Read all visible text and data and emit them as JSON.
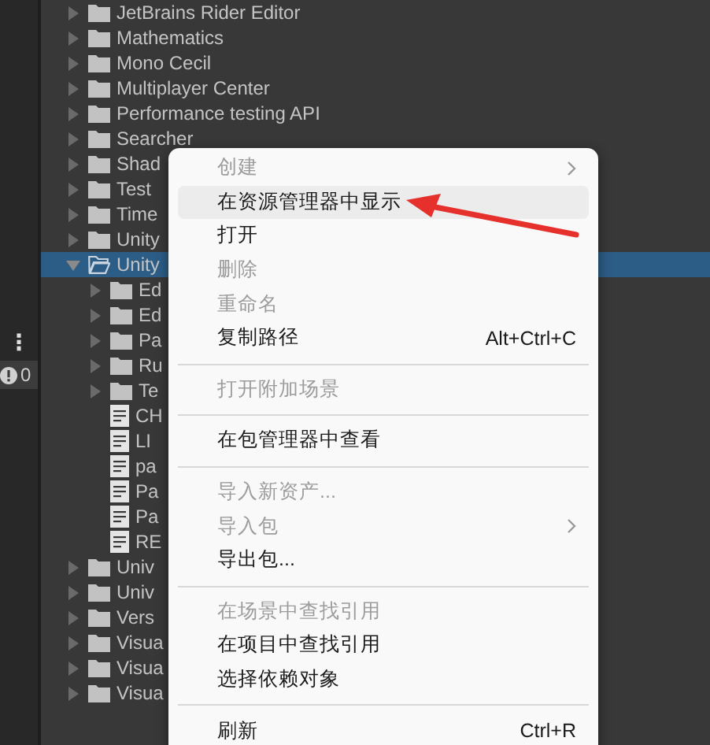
{
  "side_strip": {
    "more_glyph": "⋮",
    "count": "0"
  },
  "tree": [
    {
      "label": "JetBrains Rider Editor",
      "kind": "folder",
      "expanded": false,
      "selected": false
    },
    {
      "label": "Mathematics",
      "kind": "folder",
      "expanded": false,
      "selected": false
    },
    {
      "label": "Mono Cecil",
      "kind": "folder",
      "expanded": false,
      "selected": false
    },
    {
      "label": "Multiplayer Center",
      "kind": "folder",
      "expanded": false,
      "selected": false
    },
    {
      "label": "Performance testing API",
      "kind": "folder",
      "expanded": false,
      "selected": false
    },
    {
      "label": "Searcher",
      "kind": "folder",
      "expanded": false,
      "selected": false
    },
    {
      "label": "Shad",
      "kind": "folder",
      "expanded": false,
      "selected": false
    },
    {
      "label": "Test",
      "kind": "folder",
      "expanded": false,
      "selected": false
    },
    {
      "label": "Time",
      "kind": "folder",
      "expanded": false,
      "selected": false
    },
    {
      "label": "Unity",
      "kind": "folder",
      "expanded": false,
      "selected": false
    },
    {
      "label": "Unity",
      "kind": "folder",
      "expanded": true,
      "selected": true,
      "children": [
        {
          "label": "Ed",
          "kind": "folder",
          "expanded": false,
          "selected": false
        },
        {
          "label": "Ed",
          "kind": "folder",
          "expanded": false,
          "selected": false
        },
        {
          "label": "Pa",
          "kind": "folder",
          "expanded": false,
          "selected": false
        },
        {
          "label": "Ru",
          "kind": "folder",
          "expanded": false,
          "selected": false
        },
        {
          "label": "Te",
          "kind": "folder",
          "expanded": false,
          "selected": false
        },
        {
          "label": "CH",
          "kind": "file",
          "selected": false
        },
        {
          "label": "LI",
          "kind": "file",
          "selected": false
        },
        {
          "label": "pa",
          "kind": "file",
          "selected": false
        },
        {
          "label": "Pa",
          "kind": "file",
          "selected": false
        },
        {
          "label": "Pa",
          "kind": "file",
          "selected": false
        },
        {
          "label": "RE",
          "kind": "file",
          "selected": false
        }
      ]
    },
    {
      "label": "Univ",
      "kind": "folder",
      "expanded": false,
      "selected": false
    },
    {
      "label": "Univ",
      "kind": "folder",
      "expanded": false,
      "selected": false
    },
    {
      "label": "Vers",
      "kind": "folder",
      "expanded": false,
      "selected": false
    },
    {
      "label": "Visua",
      "kind": "folder",
      "expanded": false,
      "selected": false
    },
    {
      "label": "Visua",
      "kind": "folder",
      "expanded": false,
      "selected": false
    },
    {
      "label": "Visua",
      "kind": "folder",
      "expanded": false,
      "selected": false
    }
  ],
  "context_menu": [
    {
      "kind": "item",
      "label": "创建",
      "disabled": true,
      "submenu": true,
      "selected": false
    },
    {
      "kind": "item",
      "label": "在资源管理器中显示",
      "disabled": false,
      "submenu": false,
      "selected": true
    },
    {
      "kind": "item",
      "label": "打开",
      "disabled": false,
      "submenu": false,
      "selected": false
    },
    {
      "kind": "item",
      "label": "删除",
      "disabled": true,
      "submenu": false,
      "selected": false
    },
    {
      "kind": "item",
      "label": "重命名",
      "disabled": true,
      "submenu": false,
      "selected": false
    },
    {
      "kind": "item",
      "label": "复制路径",
      "shortcut": "Alt+Ctrl+C",
      "disabled": false,
      "submenu": false,
      "selected": false
    },
    {
      "kind": "separator"
    },
    {
      "kind": "item",
      "label": "打开附加场景",
      "disabled": true,
      "submenu": false,
      "selected": false
    },
    {
      "kind": "separator"
    },
    {
      "kind": "item",
      "label": "在包管理器中查看",
      "disabled": false,
      "submenu": false,
      "selected": false
    },
    {
      "kind": "separator"
    },
    {
      "kind": "item",
      "label": "导入新资产...",
      "disabled": true,
      "submenu": false,
      "selected": false
    },
    {
      "kind": "item",
      "label": "导入包",
      "disabled": true,
      "submenu": true,
      "selected": false
    },
    {
      "kind": "item",
      "label": "导出包...",
      "disabled": false,
      "submenu": false,
      "selected": false
    },
    {
      "kind": "separator"
    },
    {
      "kind": "item",
      "label": "在场景中查找引用",
      "disabled": true,
      "submenu": false,
      "selected": false
    },
    {
      "kind": "item",
      "label": "在项目中查找引用",
      "disabled": false,
      "submenu": false,
      "selected": false
    },
    {
      "kind": "item",
      "label": "选择依赖对象",
      "disabled": false,
      "submenu": false,
      "selected": false
    },
    {
      "kind": "separator"
    },
    {
      "kind": "item",
      "label": "刷新",
      "shortcut": "Ctrl+R",
      "disabled": false,
      "submenu": false,
      "selected": false
    }
  ]
}
